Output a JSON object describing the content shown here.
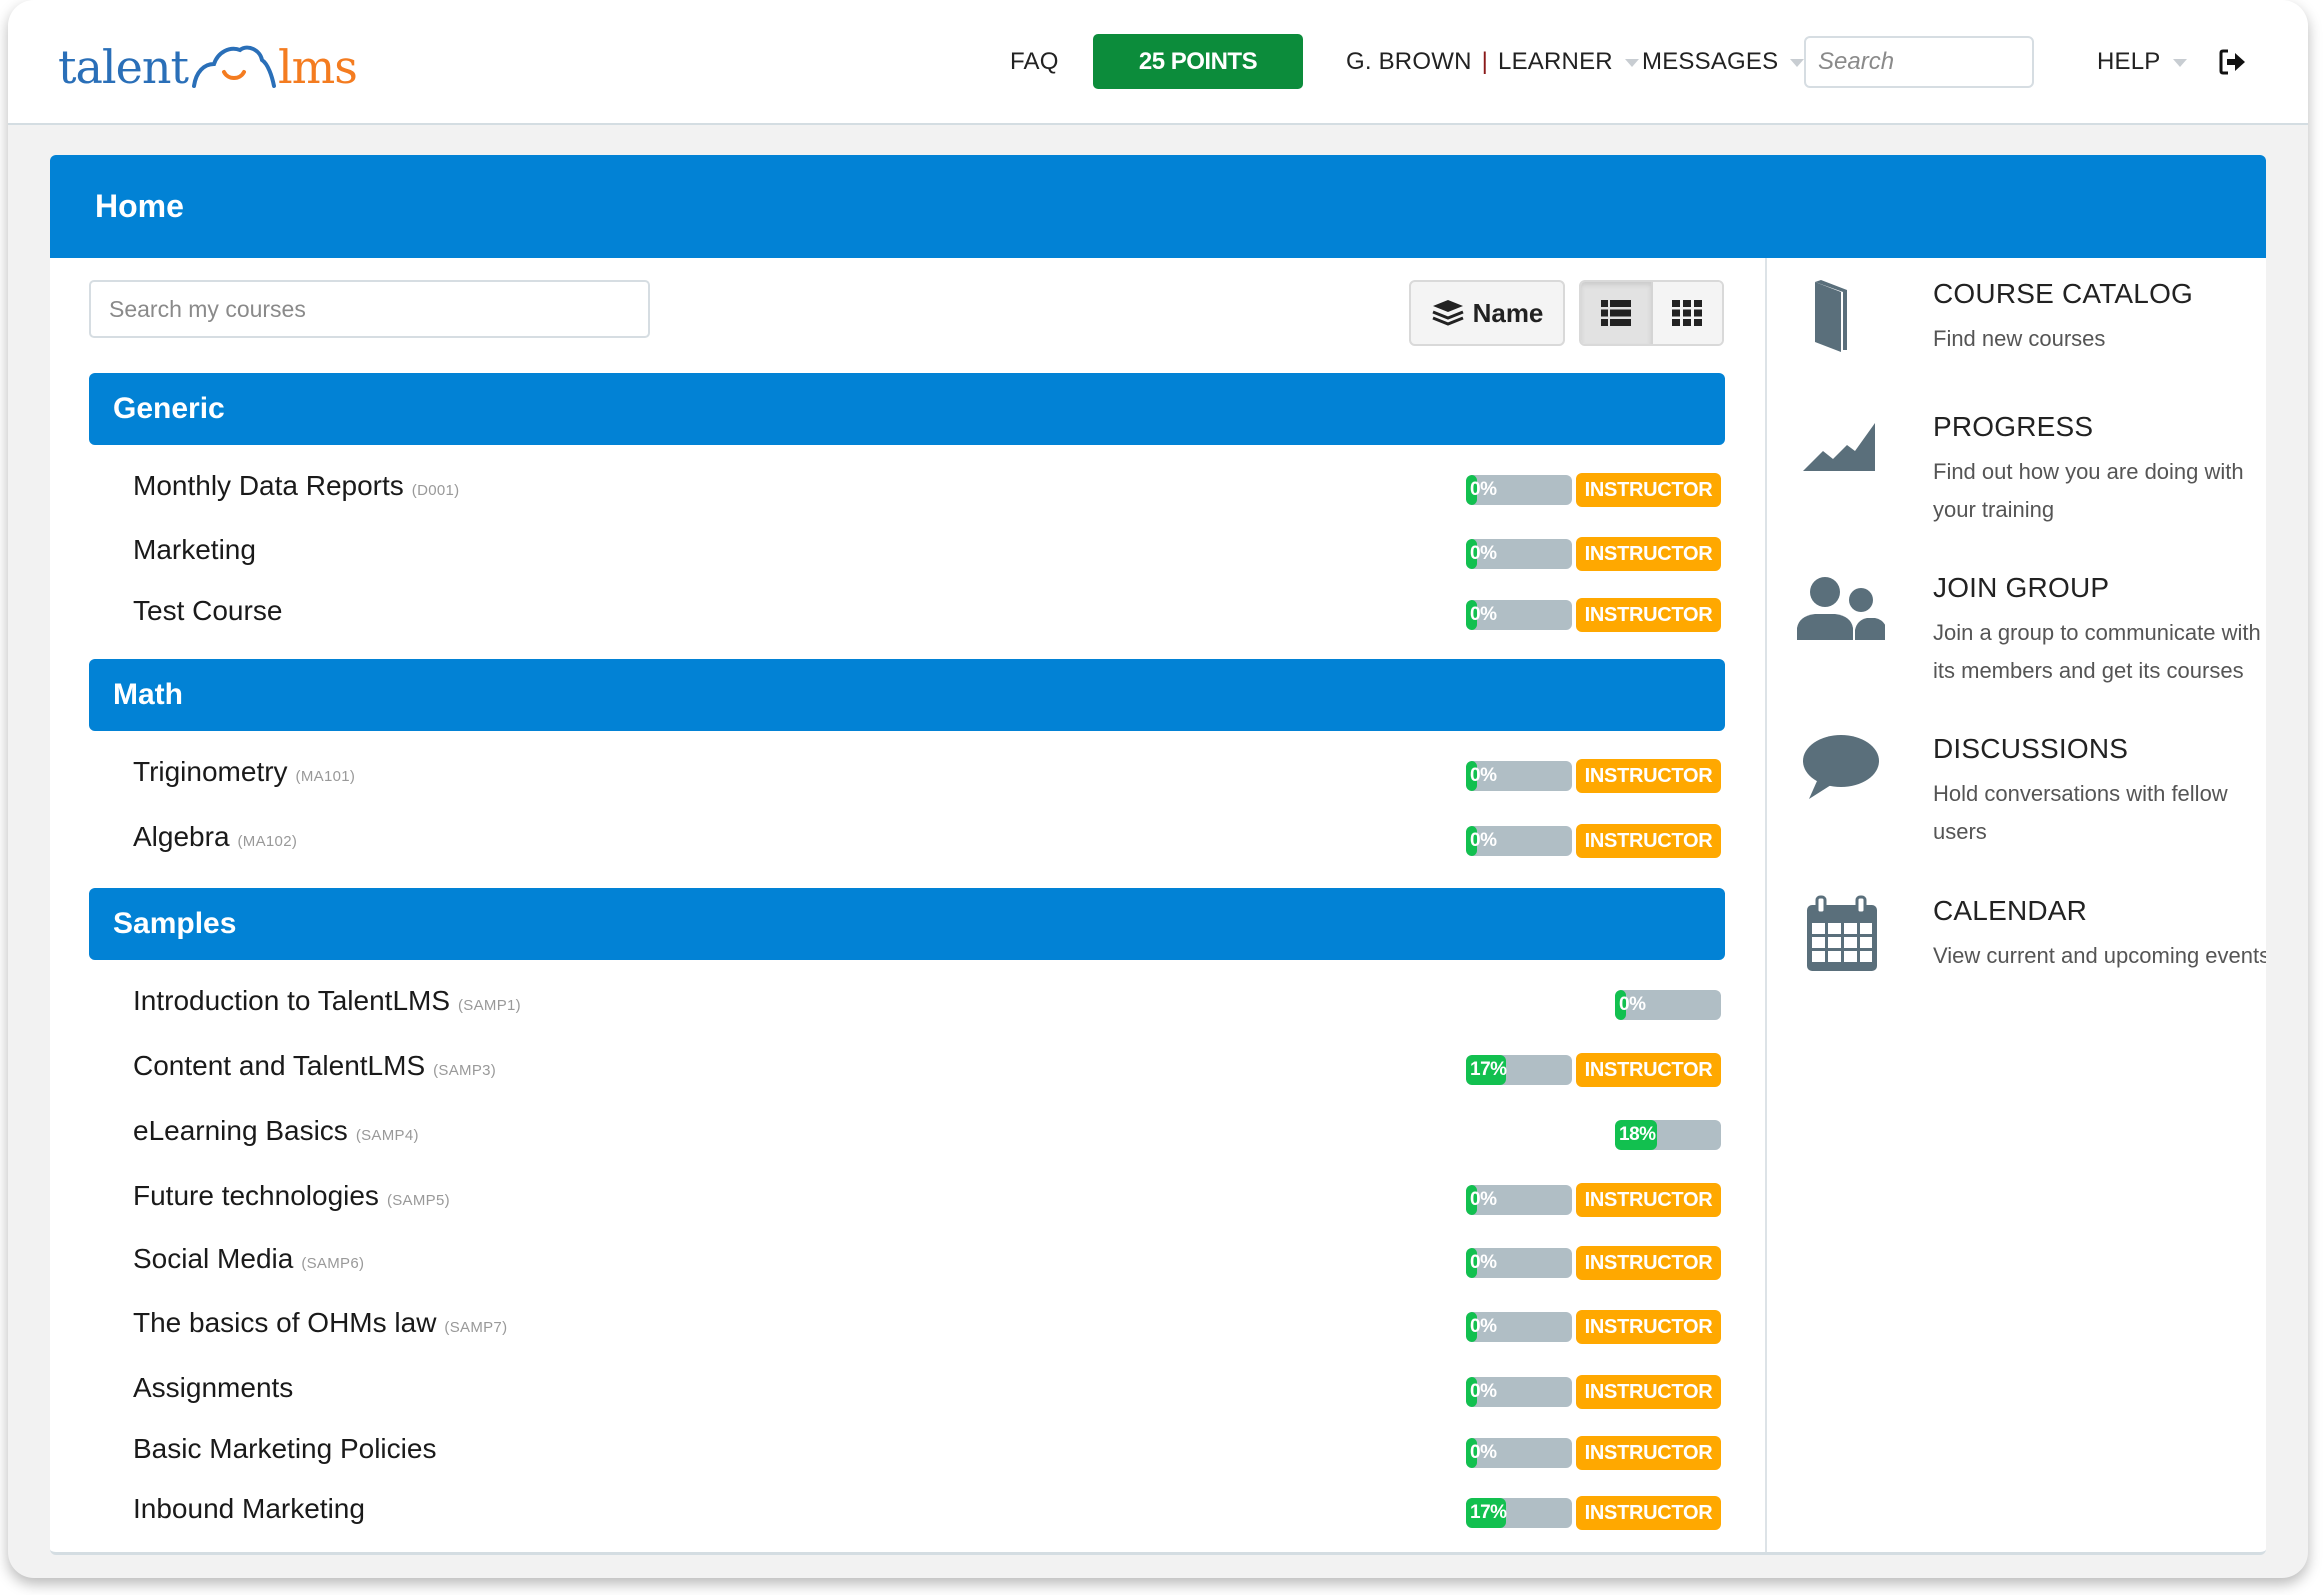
{
  "header": {
    "logo_left": "talent",
    "logo_right": "lms",
    "nav": {
      "faq": "FAQ",
      "points": "25 POINTS",
      "user_name": "G. BROWN",
      "user_separator": "|",
      "user_role": "LEARNER",
      "messages": "MESSAGES",
      "search_placeholder": "Search",
      "help": "HELP"
    },
    "icons": {
      "logout": "sign-out-icon",
      "dropdown": "caret-down-icon"
    }
  },
  "page": {
    "title": "Home",
    "course_search_placeholder": "Search my courses",
    "sort_label": "Name",
    "view_modes": [
      "list",
      "grid"
    ],
    "active_view": "list"
  },
  "categories": [
    {
      "name": "Generic",
      "courses": [
        {
          "name": "Monthly Data Reports",
          "code": "(D001)",
          "progress": 0,
          "progress_label": "0%",
          "badge": "INSTRUCTOR"
        },
        {
          "name": "Marketing",
          "code": "",
          "progress": 0,
          "progress_label": "0%",
          "badge": "INSTRUCTOR"
        },
        {
          "name": "Test Course",
          "code": "",
          "progress": 0,
          "progress_label": "0%",
          "badge": "INSTRUCTOR"
        }
      ]
    },
    {
      "name": "Math",
      "courses": [
        {
          "name": "Triginometry",
          "code": "(MA101)",
          "progress": 0,
          "progress_label": "0%",
          "badge": "INSTRUCTOR"
        },
        {
          "name": "Algebra",
          "code": "(MA102)",
          "progress": 0,
          "progress_label": "0%",
          "badge": "INSTRUCTOR"
        }
      ]
    },
    {
      "name": "Samples",
      "courses": [
        {
          "name": "Introduction to TalentLMS",
          "code": "(SAMP1)",
          "progress": 0,
          "progress_label": "0%",
          "badge": ""
        },
        {
          "name": "Content and TalentLMS",
          "code": "(SAMP3)",
          "progress": 17,
          "progress_label": "17%",
          "badge": "INSTRUCTOR"
        },
        {
          "name": "eLearning Basics",
          "code": "(SAMP4)",
          "progress": 18,
          "progress_label": "18%",
          "badge": ""
        },
        {
          "name": "Future technologies",
          "code": "(SAMP5)",
          "progress": 0,
          "progress_label": "0%",
          "badge": "INSTRUCTOR"
        },
        {
          "name": "Social Media",
          "code": "(SAMP6)",
          "progress": 0,
          "progress_label": "0%",
          "badge": "INSTRUCTOR"
        },
        {
          "name": "The basics of OHMs law",
          "code": "(SAMP7)",
          "progress": 0,
          "progress_label": "0%",
          "badge": "INSTRUCTOR"
        },
        {
          "name": "Assignments",
          "code": "",
          "progress": 0,
          "progress_label": "0%",
          "badge": "INSTRUCTOR"
        },
        {
          "name": "Basic Marketing Policies",
          "code": "",
          "progress": 0,
          "progress_label": "0%",
          "badge": "INSTRUCTOR"
        },
        {
          "name": "Inbound Marketing",
          "code": "",
          "progress": 17,
          "progress_label": "17%",
          "badge": "INSTRUCTOR"
        }
      ]
    }
  ],
  "sidebar": [
    {
      "title": "COURSE CATALOG",
      "description": "Find new courses",
      "icon": "book-icon"
    },
    {
      "title": "PROGRESS",
      "description": "Find out how you are doing with your training",
      "icon": "area-chart-icon"
    },
    {
      "title": "JOIN GROUP",
      "description": "Join a group to communicate with its members and get its courses",
      "icon": "users-icon"
    },
    {
      "title": "DISCUSSIONS",
      "description": "Hold conversations with fellow users",
      "icon": "speech-bubble-icon"
    },
    {
      "title": "CALENDAR",
      "description": "View current and upcoming events",
      "icon": "calendar-icon"
    }
  ],
  "colors": {
    "primary_blue": "#0282d5",
    "points_green": "#0c8c3b",
    "progress_green": "#12c04f",
    "progress_track": "#b0bec5",
    "instructor_orange": "#ffa800",
    "icon_slate": "#5a6f7b",
    "logo_blue": "#2a6fb8",
    "logo_orange": "#f47c20"
  }
}
